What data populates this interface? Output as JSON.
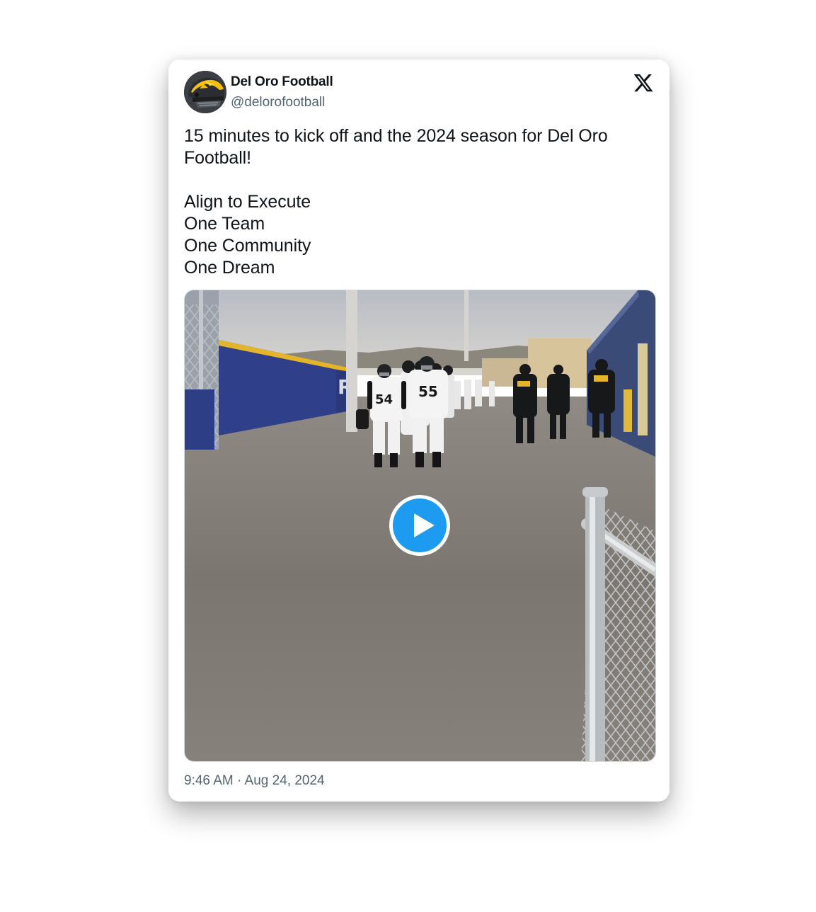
{
  "tweet": {
    "display_name": "Del Oro Football",
    "handle": "@delorofootball",
    "text": "15 minutes to kick off and the 2024 season for Del Oro Football!\n\nAlign to Execute\nOne Team\nOne Community\nOne Dream",
    "timestamp": "9:46 AM · Aug 24, 2024"
  },
  "media": {
    "type": "video",
    "jersey_numbers": [
      "54",
      "55"
    ],
    "wall_letter": "R"
  },
  "icons": {
    "brand": "x-logo-icon",
    "play": "play-icon"
  },
  "colors": {
    "text_primary": "#0f1419",
    "text_secondary": "#536471",
    "play_accent": "#1d9bf0"
  }
}
